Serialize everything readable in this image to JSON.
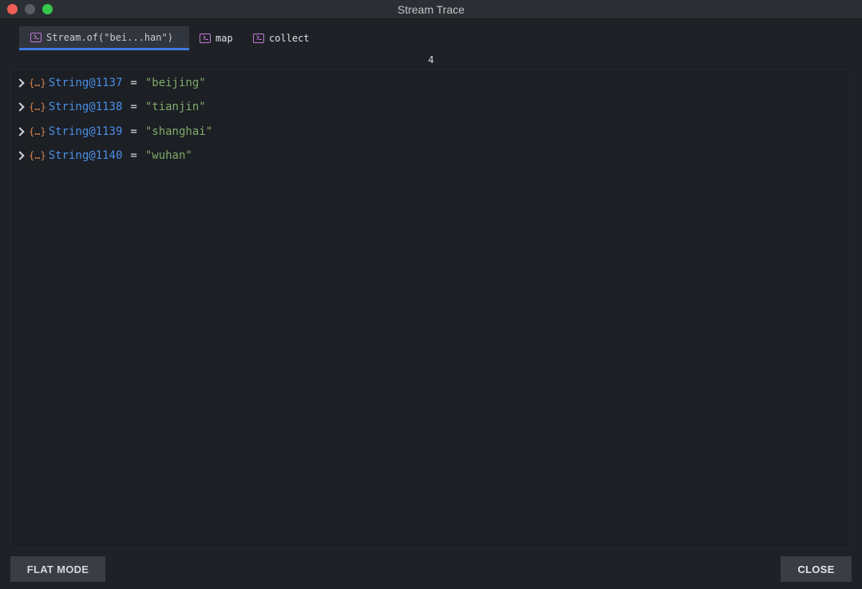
{
  "window": {
    "title": "Stream Trace"
  },
  "tabs": [
    {
      "label": "Stream.of(\"bei...han\")",
      "icon": "console-icon"
    },
    {
      "label": "map",
      "icon": "console-icon"
    },
    {
      "label": "collect",
      "icon": "console-icon"
    }
  ],
  "active_tab": 0,
  "count": "4",
  "rows": [
    {
      "name": "String@1137",
      "eq": "=",
      "value": "\"beijing\""
    },
    {
      "name": "String@1138",
      "eq": "=",
      "value": "\"tianjin\""
    },
    {
      "name": "String@1139",
      "eq": "=",
      "value": "\"shanghai\""
    },
    {
      "name": "String@1140",
      "eq": "=",
      "value": "\"wuhan\""
    }
  ],
  "object_icon_glyph": "{…}",
  "buttons": {
    "flat_mode": "FLAT MODE",
    "close": "CLOSE"
  },
  "colors": {
    "accent": "#3f7be0",
    "object_name": "#4b8fe8",
    "string_value": "#7eab6b",
    "object_icon": "#d9844f",
    "tab_icon": "#c27ad6"
  }
}
